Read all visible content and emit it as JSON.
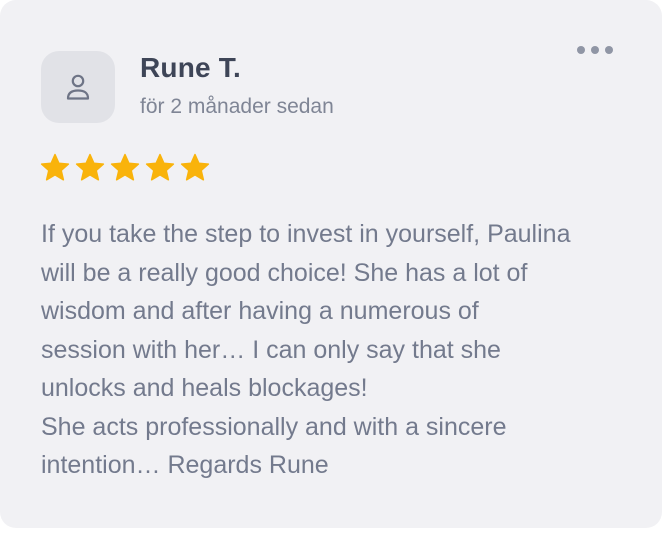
{
  "review": {
    "author": "Rune T.",
    "time_ago": "för 2 månader sedan",
    "rating": 5,
    "rating_max": 5,
    "star_color": "#f9b30b",
    "text": "If you take the step to invest in yourself, Paulina\nwill be a really good choice! She has a lot of\nwisdom and after having a numerous of\nsession with her… I can only say that she\nunlocks and heals blockages!\nShe acts professionally and with a sincere\nintention… Regards Rune"
  },
  "icons": {
    "avatar": "user-icon",
    "menu": "more-options-icon",
    "star": "star-icon"
  },
  "colors": {
    "card_background": "#f1f1f4",
    "avatar_background": "#e1e2e7",
    "name_text": "#3e4557",
    "body_text": "#737a8d"
  }
}
